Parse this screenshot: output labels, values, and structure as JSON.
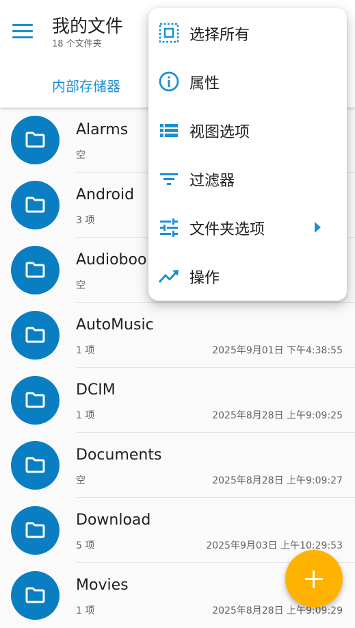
{
  "header": {
    "title": "我的文件",
    "subtitle": "18 个文件夹",
    "tab_label": "内部存储器"
  },
  "folders": [
    {
      "name": "Alarms",
      "meta": "空",
      "date": ""
    },
    {
      "name": "Android",
      "meta": "3 项",
      "date": ""
    },
    {
      "name": "Audioboo",
      "meta": "空",
      "date": ""
    },
    {
      "name": "AutoMusic",
      "meta": "1 项",
      "date": "2025年9月01日 下午4:38:55"
    },
    {
      "name": "DCIM",
      "meta": "1 项",
      "date": "2025年8月28日 上午9:09:25"
    },
    {
      "name": "Documents",
      "meta": "空",
      "date": "2025年8月28日 上午9:09:27"
    },
    {
      "name": "Download",
      "meta": "5 项",
      "date": "2025年9月03日 上午10:29:53"
    },
    {
      "name": "Movies",
      "meta": "1 项",
      "date": "2025年8月28日 上午9:09:29"
    }
  ],
  "menu": {
    "items": [
      {
        "label": "选择所有",
        "icon": "select-all-icon"
      },
      {
        "label": "属性",
        "icon": "info-icon"
      },
      {
        "label": "视图选项",
        "icon": "view-list-icon"
      },
      {
        "label": "过滤器",
        "icon": "filter-icon"
      },
      {
        "label": "文件夹选项",
        "icon": "tune-icon",
        "submenu": true
      },
      {
        "label": "操作",
        "icon": "trending-icon"
      }
    ]
  },
  "colors": {
    "accent": "#1a8fd6",
    "folder_circle": "#0a7ec2",
    "fab": "#ffb300"
  }
}
